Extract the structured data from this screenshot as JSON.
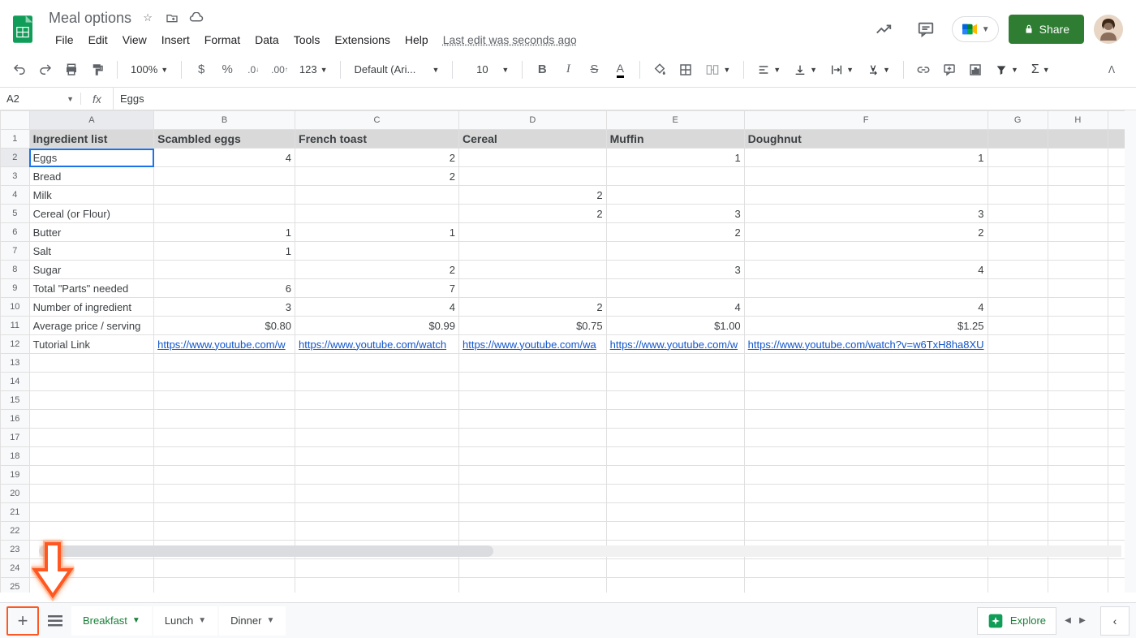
{
  "doc_title": "Meal options",
  "menubar": [
    "File",
    "Edit",
    "View",
    "Insert",
    "Format",
    "Data",
    "Tools",
    "Extensions",
    "Help"
  ],
  "last_edit": "Last edit was seconds ago",
  "share": "Share",
  "zoom": "100%",
  "font": "Default (Ari...",
  "font_size": "10",
  "name_box": "A2",
  "formula": "Eggs",
  "columns": [
    "A",
    "B",
    "C",
    "D",
    "E",
    "F",
    "G",
    "H"
  ],
  "sheet": {
    "headers": [
      "Ingredient list",
      "Scambled eggs",
      "French toast",
      "Cereal",
      "Muffin",
      "Doughnut"
    ],
    "rows": [
      {
        "label": "Eggs",
        "vals": [
          "4",
          "2",
          "",
          "1",
          "1"
        ]
      },
      {
        "label": "Bread",
        "vals": [
          "",
          "2",
          "",
          "",
          ""
        ]
      },
      {
        "label": "Milk",
        "vals": [
          "",
          "",
          "2",
          "",
          ""
        ]
      },
      {
        "label": "Cereal (or Flour)",
        "vals": [
          "",
          "",
          "2",
          "3",
          "3"
        ]
      },
      {
        "label": "Butter",
        "vals": [
          "1",
          "1",
          "",
          "2",
          "2"
        ]
      },
      {
        "label": "Salt",
        "vals": [
          "1",
          "",
          "",
          "",
          ""
        ]
      },
      {
        "label": "Sugar",
        "vals": [
          "",
          "2",
          "",
          "3",
          "4"
        ]
      },
      {
        "label": "Total \"Parts\" needed",
        "vals": [
          "6",
          "7",
          "",
          "",
          ""
        ]
      },
      {
        "label": "Number of ingredient",
        "vals": [
          "3",
          "4",
          "2",
          "4",
          "4"
        ]
      },
      {
        "label": "Average price / serving",
        "vals": [
          "$0.80",
          "$0.99",
          "$0.75",
          "$1.00",
          "$1.25"
        ]
      },
      {
        "label": "Tutorial Link",
        "vals": [
          "https://www.youtube.com/w",
          "https://www.youtube.com/watch",
          "https://www.youtube.com/wa",
          "https://www.youtube.com/w",
          "https://www.youtube.com/watch?v=w6TxH8ha8XU"
        ],
        "links": true
      }
    ]
  },
  "tabs": [
    "Breakfast",
    "Lunch",
    "Dinner"
  ],
  "active_tab": 0,
  "explore": "Explore"
}
